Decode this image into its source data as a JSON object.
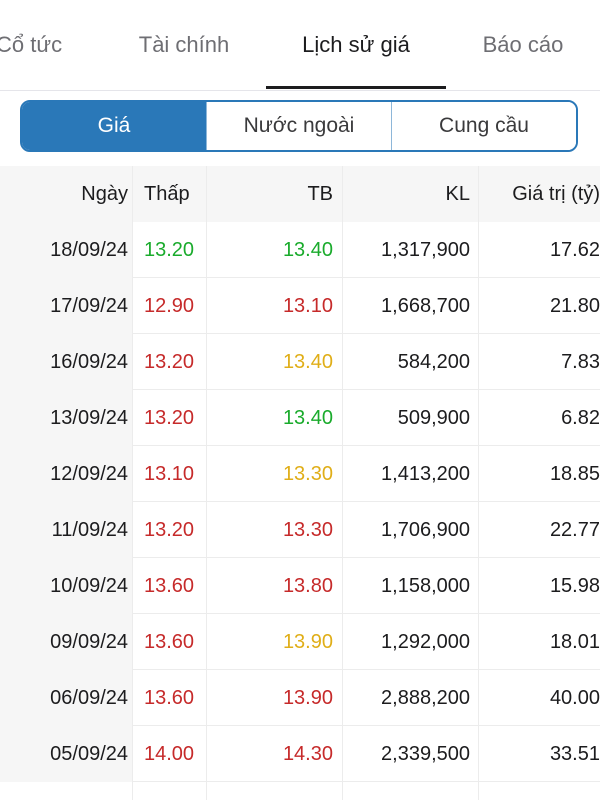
{
  "tabs": [
    {
      "label": "Cổ tức",
      "active": false
    },
    {
      "label": "Tài chính",
      "active": false
    },
    {
      "label": "Lịch sử giá",
      "active": true
    },
    {
      "label": "Báo cáo",
      "active": false
    }
  ],
  "segments": [
    {
      "label": "Giá",
      "active": true
    },
    {
      "label": "Nước ngoài",
      "active": false
    },
    {
      "label": "Cung cầu",
      "active": false
    }
  ],
  "colors": {
    "accent": "#2a78b8",
    "up": "#1aab2c",
    "down": "#c62a2a",
    "reference": "#e0ae18"
  },
  "table": {
    "headers": [
      "Ngày",
      "Thấp",
      "TB",
      "KL",
      "Giá trị (tỷ)"
    ],
    "rows": [
      {
        "date": "18/09/24",
        "low": "13.20",
        "low_color": "green",
        "avg": "13.40",
        "avg_color": "green",
        "vol": "1,317,900",
        "value": "17.62"
      },
      {
        "date": "17/09/24",
        "low": "12.90",
        "low_color": "red",
        "avg": "13.10",
        "avg_color": "red",
        "vol": "1,668,700",
        "value": "21.80"
      },
      {
        "date": "16/09/24",
        "low": "13.20",
        "low_color": "red",
        "avg": "13.40",
        "avg_color": "yellow",
        "vol": "584,200",
        "value": "7.83"
      },
      {
        "date": "13/09/24",
        "low": "13.20",
        "low_color": "red",
        "avg": "13.40",
        "avg_color": "green",
        "vol": "509,900",
        "value": "6.82"
      },
      {
        "date": "12/09/24",
        "low": "13.10",
        "low_color": "red",
        "avg": "13.30",
        "avg_color": "yellow",
        "vol": "1,413,200",
        "value": "18.85"
      },
      {
        "date": "11/09/24",
        "low": "13.20",
        "low_color": "red",
        "avg": "13.30",
        "avg_color": "red",
        "vol": "1,706,900",
        "value": "22.77"
      },
      {
        "date": "10/09/24",
        "low": "13.60",
        "low_color": "red",
        "avg": "13.80",
        "avg_color": "red",
        "vol": "1,158,000",
        "value": "15.98"
      },
      {
        "date": "09/09/24",
        "low": "13.60",
        "low_color": "red",
        "avg": "13.90",
        "avg_color": "yellow",
        "vol": "1,292,000",
        "value": "18.01"
      },
      {
        "date": "06/09/24",
        "low": "13.60",
        "low_color": "red",
        "avg": "13.90",
        "avg_color": "red",
        "vol": "2,888,200",
        "value": "40.00"
      },
      {
        "date": "05/09/24",
        "low": "14.00",
        "low_color": "red",
        "avg": "14.30",
        "avg_color": "red",
        "vol": "2,339,500",
        "value": "33.51"
      }
    ]
  }
}
